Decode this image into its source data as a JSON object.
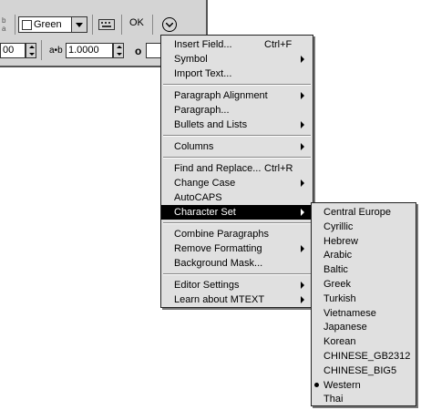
{
  "toolbar": {
    "color_value": "Green",
    "ok_label": "OK",
    "field_left_value": "00",
    "field_tracking_value": "1.0000",
    "tracking_label": "a•b"
  },
  "context_menu": {
    "items": [
      {
        "label": "Insert Field...",
        "shortcut": "Ctrl+F"
      },
      {
        "label": "Symbol",
        "submenu": true
      },
      {
        "label": "Import Text..."
      },
      {
        "label": "Paragraph Alignment",
        "submenu": true
      },
      {
        "label": "Paragraph..."
      },
      {
        "label": "Bullets and Lists",
        "submenu": true
      },
      {
        "label": "Columns",
        "submenu": true
      },
      {
        "label": "Find and Replace...",
        "shortcut": "Ctrl+R"
      },
      {
        "label": "Change Case",
        "submenu": true
      },
      {
        "label": "AutoCAPS"
      },
      {
        "label": "Character Set",
        "submenu": true,
        "highlighted": true
      },
      {
        "label": "Combine Paragraphs"
      },
      {
        "label": "Remove Formatting",
        "submenu": true
      },
      {
        "label": "Background Mask..."
      },
      {
        "label": "Editor Settings",
        "submenu": true
      },
      {
        "label": "Learn about MTEXT",
        "submenu": true
      }
    ]
  },
  "charset_menu": {
    "items": [
      {
        "label": "Central Europe"
      },
      {
        "label": "Cyrillic"
      },
      {
        "label": "Hebrew"
      },
      {
        "label": "Arabic"
      },
      {
        "label": "Baltic"
      },
      {
        "label": "Greek"
      },
      {
        "label": "Turkish"
      },
      {
        "label": "Vietnamese"
      },
      {
        "label": "Japanese"
      },
      {
        "label": "Korean"
      },
      {
        "label": "CHINESE_GB2312"
      },
      {
        "label": "CHINESE_BIG5"
      },
      {
        "label": "Western",
        "checked": true
      },
      {
        "label": "Thai"
      }
    ]
  }
}
